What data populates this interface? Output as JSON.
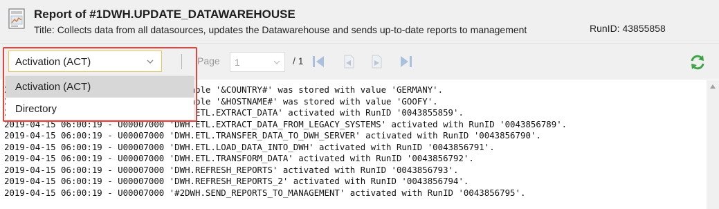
{
  "header": {
    "title": "Report of #1DWH.UPDATE_DATAWAREHOUSE",
    "subtitle": "Title: Collects data from all datasources, updates the Datawarehouse and sends up-to-date reports to management",
    "runid": "RunID: 43855858",
    "icon": "report-document-icon"
  },
  "toolbar": {
    "selected": "Activation (ACT)",
    "page_label": "Page",
    "page_value": "1",
    "page_total": "/ 1",
    "options": [
      "Activation (ACT)",
      "Directory"
    ],
    "accent": "#e0453f",
    "refresh_color": "#3aa644"
  },
  "log": {
    "lines": [
      "2019-04-15 06:00:19 - U00007000 Variable '&COUNTRY#' was stored with value 'GERMANY'.",
      "2019-04-15 06:00:19 - U00007000 Variable '&HOSTNAME#' was stored with value 'GOOFY'.",
      "2019-04-15 06:00:19 - U00007000 'DWH.ETL.EXTRACT_DATA' activated with RunID '0043855859'.",
      "2019-04-15 06:00:19 - U00007000 'DWH.ETL.EXTRACT_DATA_FROM_LEGACY_SYSTEMS' activated with RunID '0043856789'.",
      "2019-04-15 06:00:19 - U00007000 'DWH.ETL.TRANSFER_DATA_TO_DWH_SERVER' activated with RunID '0043856790'.",
      "2019-04-15 06:00:19 - U00007000 'DWH.ETL.LOAD_DATA_INTO_DWH' activated with RunID '0043856791'.",
      "2019-04-15 06:00:19 - U00007000 'DWH.ETL.TRANSFORM_DATA' activated with RunID '0043856792'.",
      "2019-04-15 06:00:19 - U00007000 'DWH.REFRESH_REPORTS' activated with RunID '0043856793'.",
      "2019-04-15 06:00:19 - U00007000 'DWH.REFRESH_REPORTS_2' activated with RunID '0043856794'.",
      "2019-04-15 06:00:19 - U00007000 '#2DWH.SEND_REPORTS_TO_MANAGEMENT' activated with RunID '0043856795'."
    ]
  }
}
